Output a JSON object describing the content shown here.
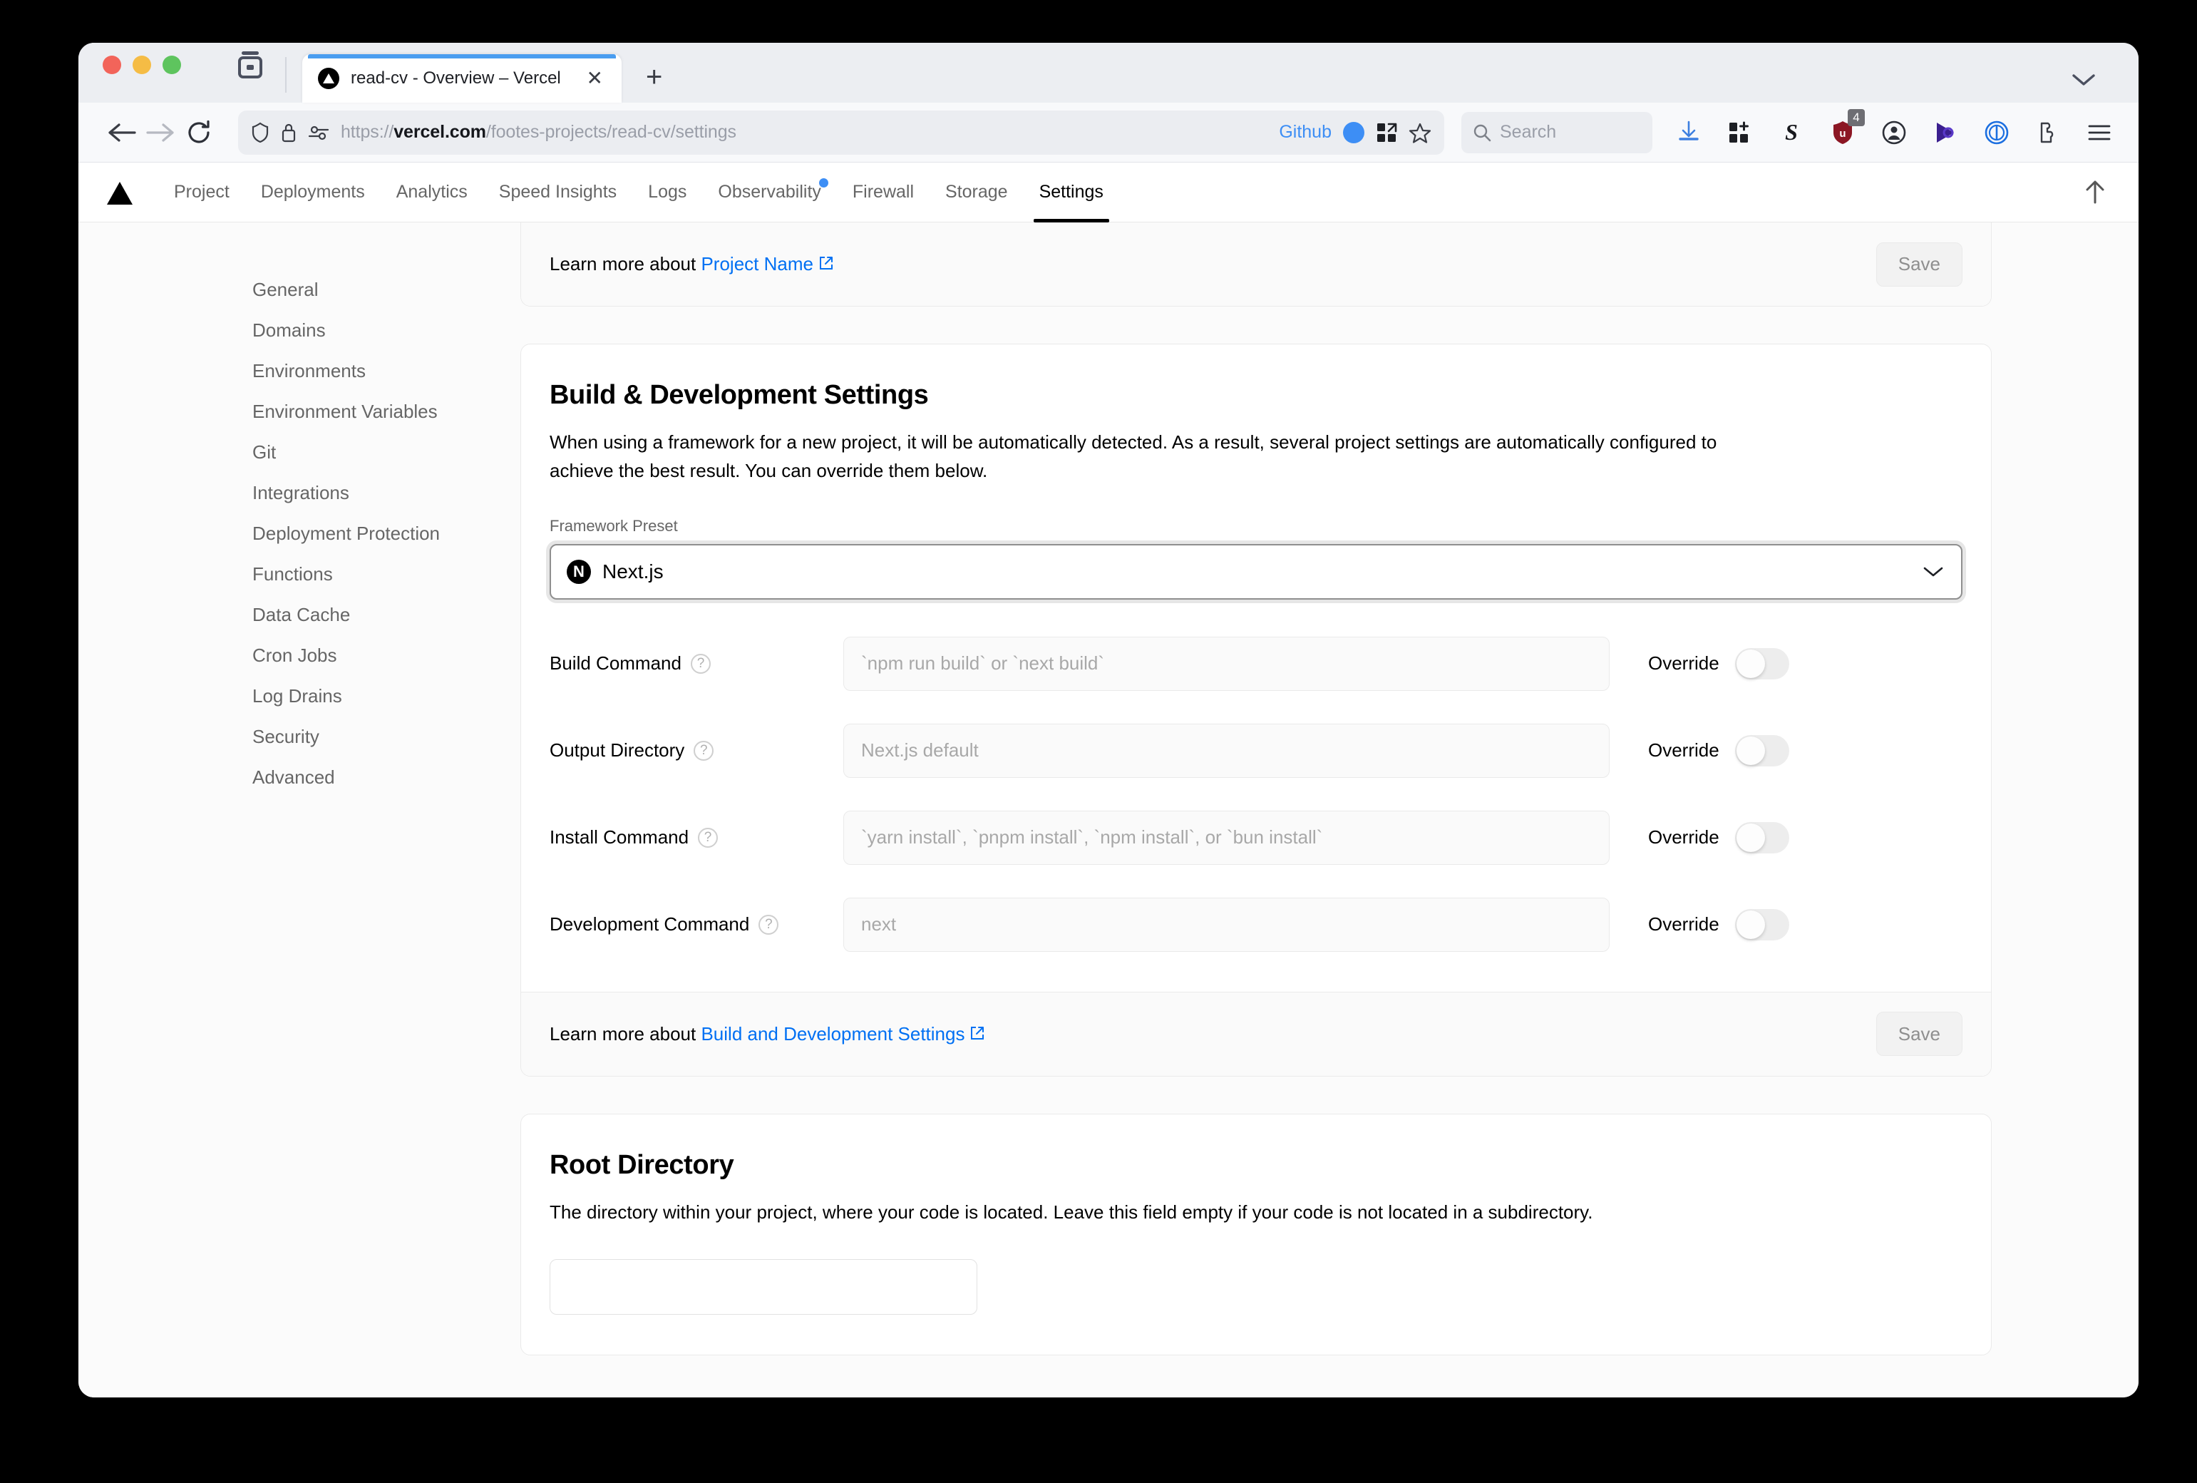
{
  "browser": {
    "tab": {
      "title": "read-cv - Overview – Vercel",
      "close_label": "✕"
    },
    "new_tab_label": "+",
    "url": {
      "domain": "vercel.com",
      "prefix": "https://",
      "path": "/footes-projects/read-cv/settings",
      "github_badge": "Github"
    },
    "search": {
      "placeholder": "Search"
    },
    "extensions": [
      {
        "name": "downloads-icon",
        "label": ""
      },
      {
        "name": "extensions-grid-icon",
        "label": ""
      },
      {
        "name": "stripe-s-icon",
        "label": "S"
      },
      {
        "name": "shield-blocker-icon",
        "label": "",
        "badge": "4"
      },
      {
        "name": "account-icon",
        "label": ""
      },
      {
        "name": "play-icon",
        "label": ""
      },
      {
        "name": "circle-icon",
        "label": ""
      },
      {
        "name": "puzzle-icon",
        "label": ""
      },
      {
        "name": "menu-icon",
        "label": ""
      }
    ]
  },
  "vercel_nav": {
    "items": [
      {
        "label": "Project",
        "active": false,
        "dot": false
      },
      {
        "label": "Deployments",
        "active": false,
        "dot": false
      },
      {
        "label": "Analytics",
        "active": false,
        "dot": false
      },
      {
        "label": "Speed Insights",
        "active": false,
        "dot": false
      },
      {
        "label": "Logs",
        "active": false,
        "dot": false
      },
      {
        "label": "Observability",
        "active": false,
        "dot": true
      },
      {
        "label": "Firewall",
        "active": false,
        "dot": false
      },
      {
        "label": "Storage",
        "active": false,
        "dot": false
      },
      {
        "label": "Settings",
        "active": true,
        "dot": false
      }
    ]
  },
  "sidebar": {
    "items": [
      {
        "label": "General"
      },
      {
        "label": "Domains"
      },
      {
        "label": "Environments"
      },
      {
        "label": "Environment Variables"
      },
      {
        "label": "Git"
      },
      {
        "label": "Integrations"
      },
      {
        "label": "Deployment Protection"
      },
      {
        "label": "Functions"
      },
      {
        "label": "Data Cache"
      },
      {
        "label": "Cron Jobs"
      },
      {
        "label": "Log Drains"
      },
      {
        "label": "Security"
      },
      {
        "label": "Advanced"
      }
    ]
  },
  "project_name_card": {
    "footer_prefix": "Learn more about ",
    "footer_link": "Project Name",
    "save_label": "Save"
  },
  "build_card": {
    "title": "Build & Development Settings",
    "description": "When using a framework for a new project, it will be automatically detected. As a result, several project settings are automatically configured to achieve the best result. You can override them below.",
    "framework_label": "Framework Preset",
    "framework_value": "Next.js",
    "framework_badge_letter": "N",
    "rows": [
      {
        "label": "Build Command",
        "placeholder": "`npm run build` or `next build`",
        "override_label": "Override",
        "override_on": false
      },
      {
        "label": "Output Directory",
        "placeholder": "Next.js default",
        "override_label": "Override",
        "override_on": false
      },
      {
        "label": "Install Command",
        "placeholder": "`yarn install`, `pnpm install`, `npm install`, or `bun install`",
        "override_label": "Override",
        "override_on": false
      },
      {
        "label": "Development Command",
        "placeholder": "next",
        "override_label": "Override",
        "override_on": false
      }
    ],
    "footer_prefix": "Learn more about ",
    "footer_link": "Build and Development Settings",
    "save_label": "Save"
  },
  "root_directory_card": {
    "title": "Root Directory",
    "description": "The directory within your project, where your code is located. Leave this field empty if your code is not located in a subdirectory.",
    "input_value": ""
  },
  "colors": {
    "accent_blue": "#0070f3",
    "link_blue": "#3d8ef5",
    "active_underline": "#000000",
    "nav_dot": "#3d8ef5"
  }
}
